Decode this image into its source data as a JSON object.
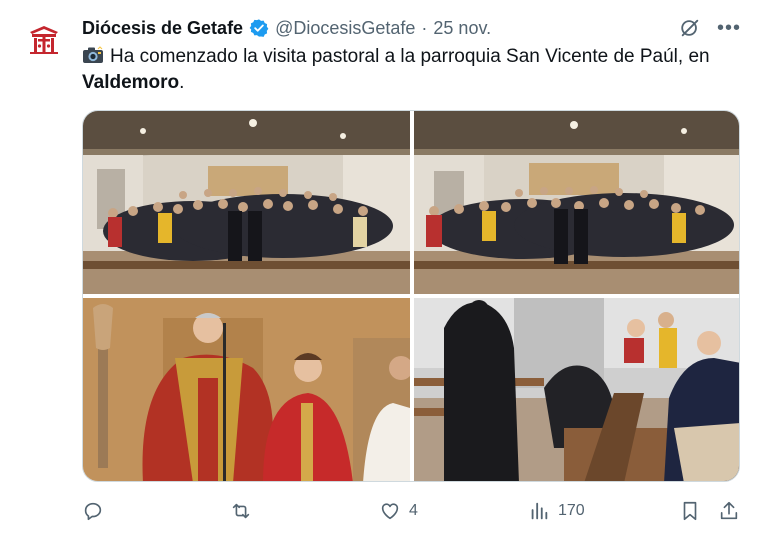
{
  "tweet": {
    "author_name": "Diócesis de Getafe",
    "handle": "@DiocesisGetafe",
    "separator": "·",
    "date": "25 nov.",
    "text_main": "Ha comenzado la visita pastoral a la parroquia San Vicente de Paúl, en",
    "text_bold": "Valdemoro",
    "text_end": "."
  },
  "icons": {
    "avatar": "diocese-coat-of-arms",
    "verified": "verified-badge-icon",
    "grok": "grok-icon",
    "more": "more-icon",
    "camera": "camera-emoji"
  },
  "media": {
    "photos": [
      {
        "subject": "group-photo-hall-left"
      },
      {
        "subject": "group-photo-hall-right"
      },
      {
        "subject": "priests-red-vestments"
      },
      {
        "subject": "congregation-pews"
      }
    ]
  },
  "actions": {
    "reply_count": "",
    "retweet_count": "",
    "like_count": "4",
    "views_count": "170"
  },
  "colors": {
    "verified_blue": "#1d9bf0",
    "text_gray": "#536471",
    "text_dark": "#0f1419"
  }
}
